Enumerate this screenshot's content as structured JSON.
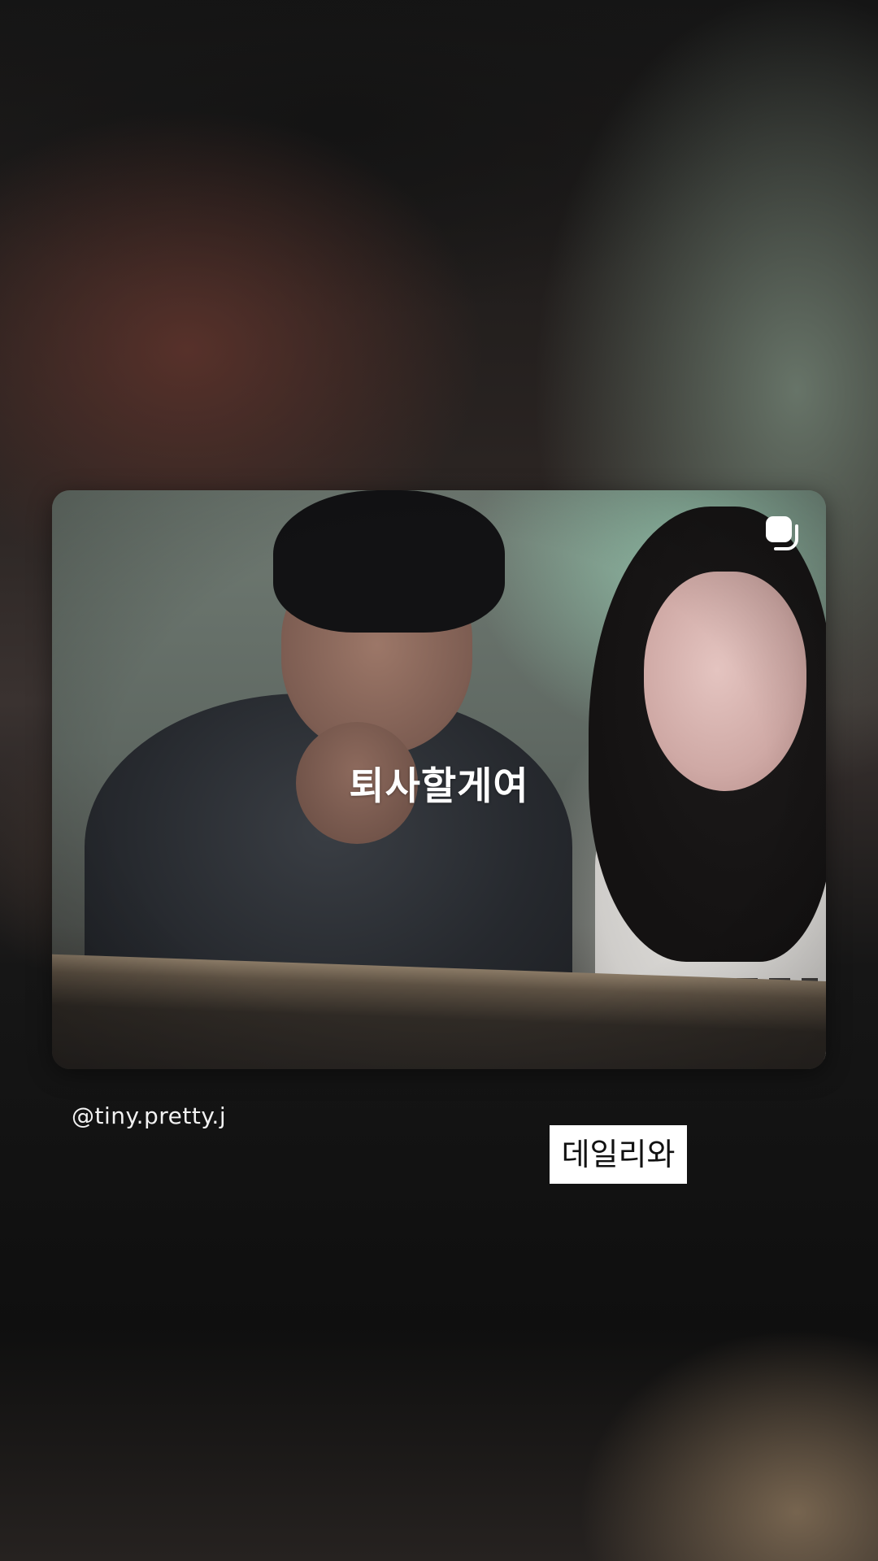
{
  "post": {
    "caption": "퇴사할게여",
    "multi_photo_icon": "carousel-icon",
    "username": "@tiny.pretty.j"
  },
  "sticker": {
    "text": "데일리와"
  }
}
